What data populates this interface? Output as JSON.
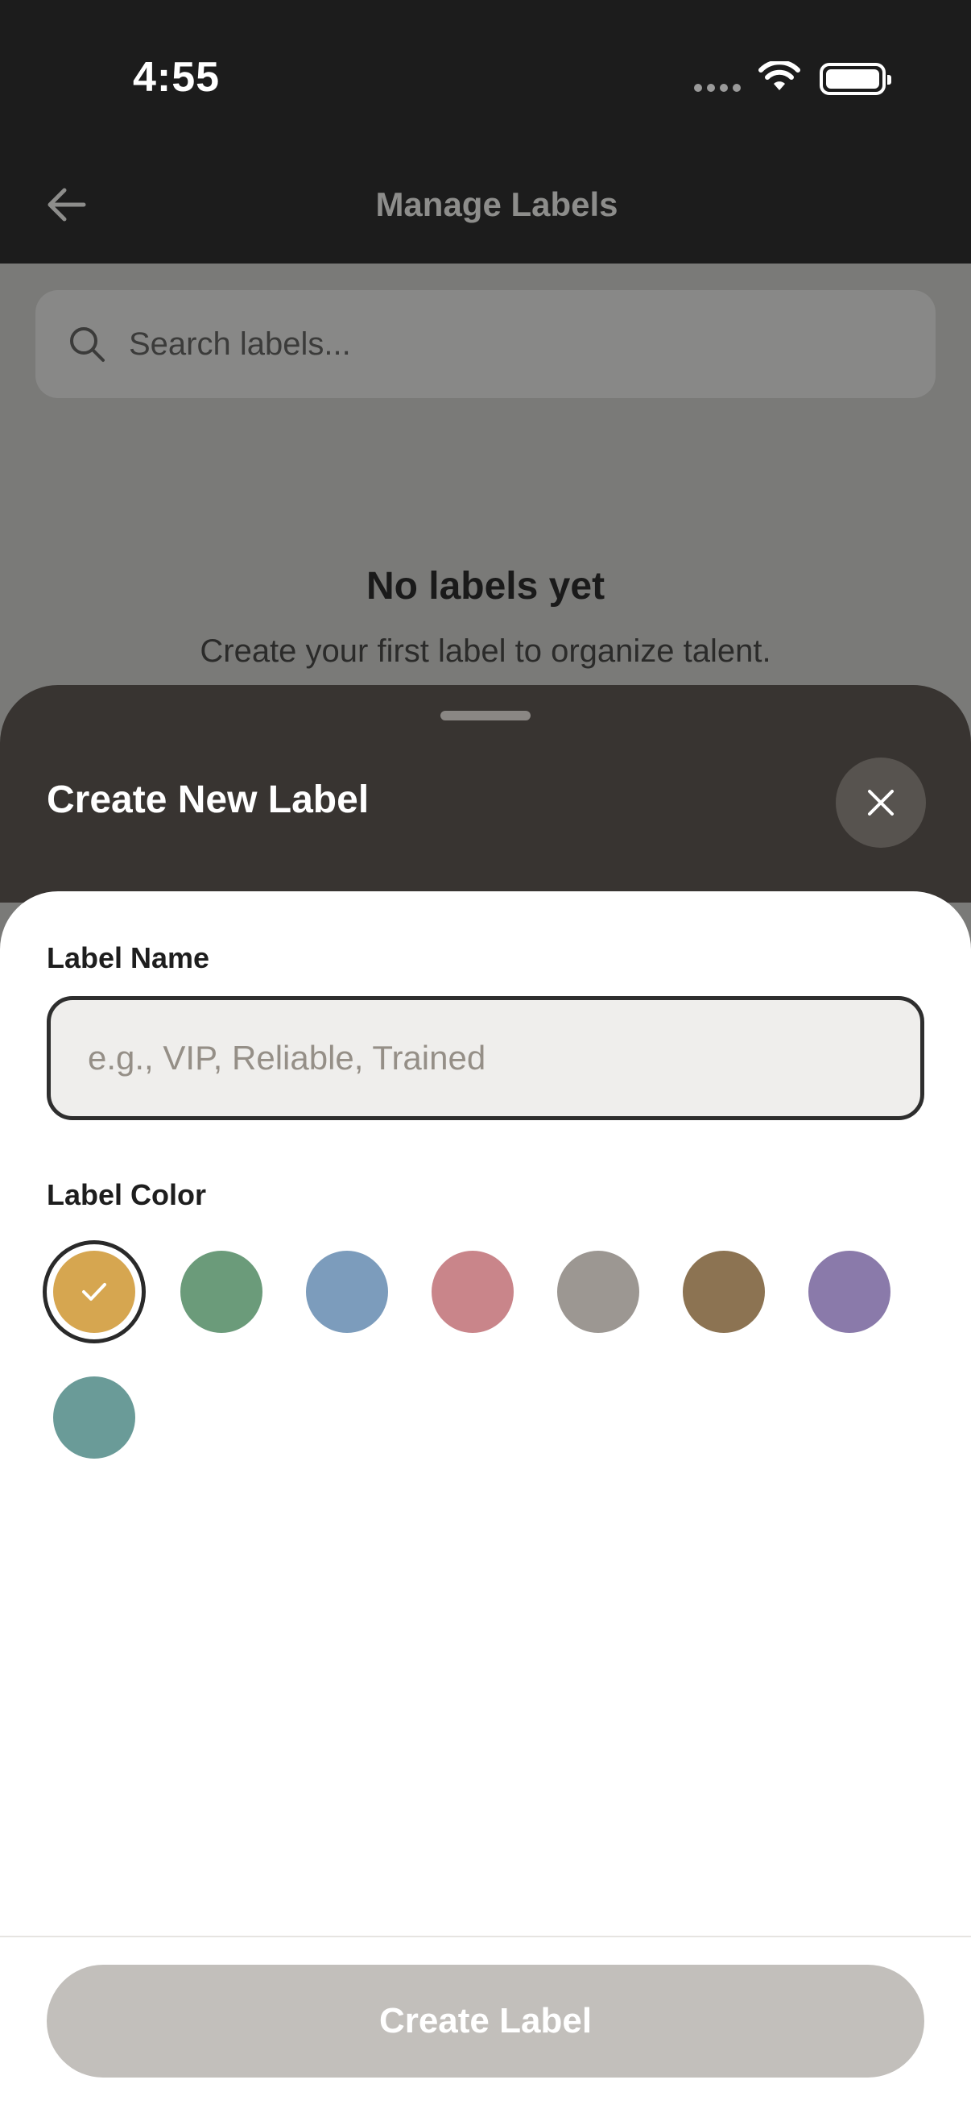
{
  "status_bar": {
    "time": "4:55"
  },
  "header": {
    "title": "Manage Labels",
    "back_icon": "arrow-left-icon"
  },
  "search": {
    "placeholder": "Search labels..."
  },
  "empty_state": {
    "title": "No labels yet",
    "subtitle": "Create your first label to organize talent."
  },
  "sheet": {
    "title": "Create New Label",
    "close_icon": "close-icon",
    "name_label": "Label Name",
    "name_value": "",
    "name_placeholder": "e.g., VIP, Reliable, Trained",
    "color_label": "Label Color",
    "colors": [
      {
        "hex": "#D6A650",
        "selected": true
      },
      {
        "hex": "#6B9B7A",
        "selected": false
      },
      {
        "hex": "#7C9CBC",
        "selected": false
      },
      {
        "hex": "#C9858A",
        "selected": false
      },
      {
        "hex": "#9C9792",
        "selected": false
      },
      {
        "hex": "#8C7352",
        "selected": false
      },
      {
        "hex": "#8A7AAA",
        "selected": false
      },
      {
        "hex": "#6A9B98",
        "selected": false
      }
    ],
    "submit_label": "Create Label"
  }
}
